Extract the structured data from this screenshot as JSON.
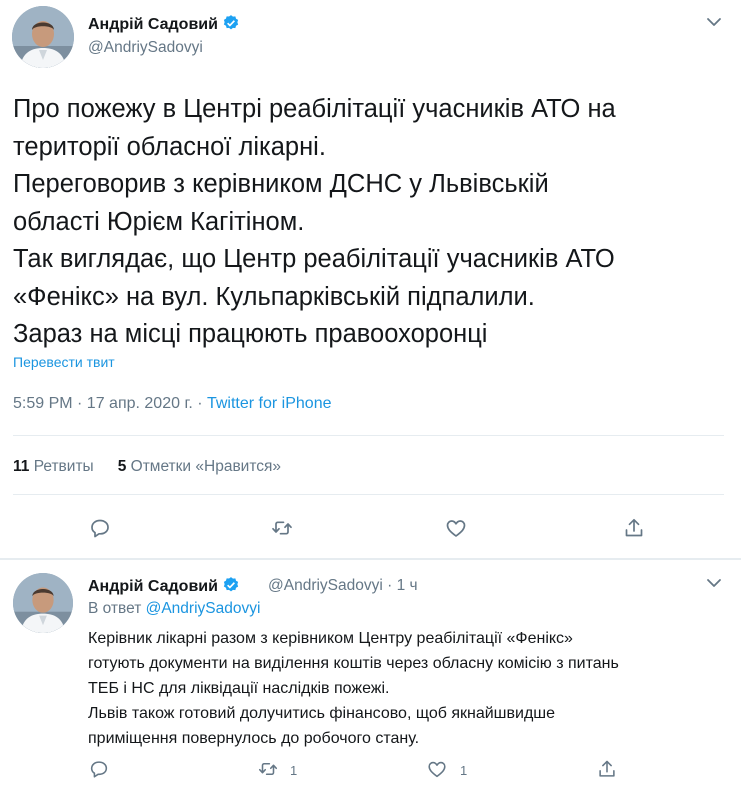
{
  "main_tweet": {
    "author_name": "Андрій Садовий",
    "handle": "@AndriySadovyi",
    "text_lines": [
      "Про пожежу в Центрі реабілітації учасників АТО на",
      "території обласної лікарні.",
      "Переговорив з керівником ДСНС у Львівській",
      "області Юрієм Кагітіном.",
      "Так виглядає, що Центр реабілітації учасників АТО",
      "«Фенікс» на вул. Кульпарківській підпалили.",
      "Зараз на місці працюють правоохоронці"
    ],
    "translate_label": "Перевести твит",
    "time": "5:59 PM · 17 апр. 2020 г. · ",
    "source": "Twitter for iPhone",
    "retweets_count": "11",
    "retweets_label": " Ретвиты",
    "likes_count": "5",
    "likes_label": " Отметки «Нравится»"
  },
  "reply_tweet": {
    "author_name": "Андрій Садовий",
    "handle": "@AndriySadovyi · 1 ч",
    "in_reply_prefix": "В ответ ",
    "in_reply_handle": "@AndriySadovyi",
    "text_lines": [
      "Керівник лікарні разом з керівником Центру реабілітації «Фенікс»",
      "готують документи на виділення коштів через обласну комісію з питань",
      "ТЕБ і НС для ліквідації наслідків пожежі.",
      "Львів також готовий долучитись фінансово, щоб якнайшвидше",
      "приміщення повернулось до робочого стану."
    ],
    "retweet_count": "1",
    "like_count": "1"
  },
  "colors": {
    "link_blue": "#1b95e0",
    "secondary_gray": "#657786",
    "text_dark": "#14171a",
    "verified_blue": "#1da1f2",
    "divider": "#e6ecf0"
  },
  "icons": [
    "reply-icon",
    "retweet-icon",
    "like-icon",
    "share-icon",
    "verified-badge-icon",
    "chevron-down-icon"
  ]
}
